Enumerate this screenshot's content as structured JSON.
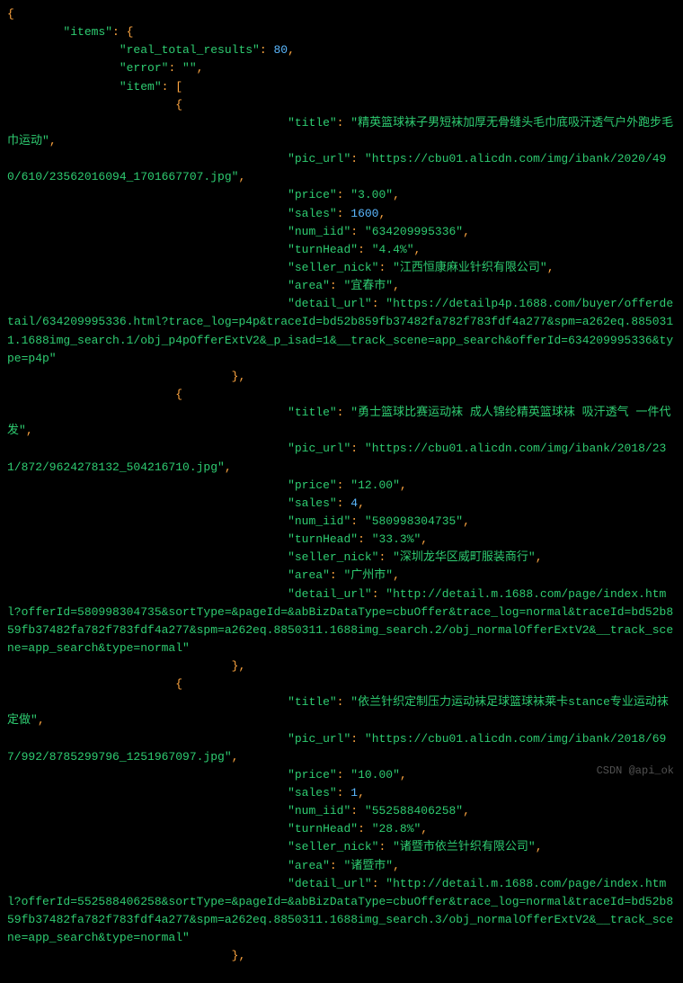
{
  "indent": {
    "i0": "",
    "i1": "        ",
    "i2": "                ",
    "i3": "                        ",
    "i4": "                                ",
    "i5": "                                        "
  },
  "tok": {
    "lbrace": "{",
    "rbrace": "}",
    "lbracket": "[",
    "rbracket": "]",
    "comma": ",",
    "colon": ": ",
    "rbrace_c": "},"
  },
  "keys": {
    "items": "\"items\"",
    "real_total_results": "\"real_total_results\"",
    "error": "\"error\"",
    "item": "\"item\"",
    "title": "\"title\"",
    "pic_url": "\"pic_url\"",
    "price": "\"price\"",
    "sales": "\"sales\"",
    "num_iid": "\"num_iid\"",
    "turnHead": "\"turnHead\"",
    "seller_nick": "\"seller_nick\"",
    "area": "\"area\"",
    "detail_url": "\"detail_url\""
  },
  "header": {
    "real_total_results": "80",
    "error": "\"\""
  },
  "items": [
    {
      "title": "\"精英篮球袜子男短袜加厚无骨缝头毛巾底吸汗透气户外跑步毛巾运动\"",
      "pic_url": "\"https://cbu01.alicdn.com/img/ibank/2020/490/610/23562016094_1701667707.jpg\"",
      "price": "\"3.00\"",
      "sales": "1600",
      "num_iid": "\"634209995336\"",
      "turnHead": "\"4.4%\"",
      "seller_nick": "\"江西恒康麻业针织有限公司\"",
      "area": "\"宜春市\"",
      "detail_url": "\"https://detailp4p.1688.com/buyer/offerdetail/634209995336.html?trace_log=p4p&traceId=bd52b859fb37482fa782f783fdf4a277&spm=a262eq.8850311.1688img_search.1/obj_p4pOfferExtV2&_p_isad=1&__track_scene=app_search&offerId=634209995336&type=p4p\""
    },
    {
      "title": "\"勇士篮球比赛运动袜 成人锦纶精英篮球袜 吸汗透气 一件代发\"",
      "pic_url": "\"https://cbu01.alicdn.com/img/ibank/2018/231/872/9624278132_504216710.jpg\"",
      "price": "\"12.00\"",
      "sales": "4",
      "num_iid": "\"580998304735\"",
      "turnHead": "\"33.3%\"",
      "seller_nick": "\"深圳龙华区威町服装商行\"",
      "area": "\"广州市\"",
      "detail_url": "\"http://detail.m.1688.com/page/index.html?offerId=580998304735&sortType=&pageId=&abBizDataType=cbuOffer&trace_log=normal&traceId=bd52b859fb37482fa782f783fdf4a277&spm=a262eq.8850311.1688img_search.2/obj_normalOfferExtV2&__track_scene=app_search&type=normal\""
    },
    {
      "title": "\"依兰针织定制压力运动袜足球篮球袜莱卡stance专业运动袜定做\"",
      "pic_url": "\"https://cbu01.alicdn.com/img/ibank/2018/697/992/8785299796_1251967097.jpg\"",
      "price": "\"10.00\"",
      "sales": "1",
      "num_iid": "\"552588406258\"",
      "turnHead": "\"28.8%\"",
      "seller_nick": "\"诸暨市依兰针织有限公司\"",
      "area": "\"诸暨市\"",
      "detail_url": "\"http://detail.m.1688.com/page/index.html?offerId=552588406258&sortType=&pageId=&abBizDataType=cbuOffer&trace_log=normal&traceId=bd52b859fb37482fa782f783fdf4a277&spm=a262eq.8850311.1688img_search.3/obj_normalOfferExtV2&__track_scene=app_search&type=normal\""
    }
  ],
  "watermark": "CSDN @api_ok"
}
